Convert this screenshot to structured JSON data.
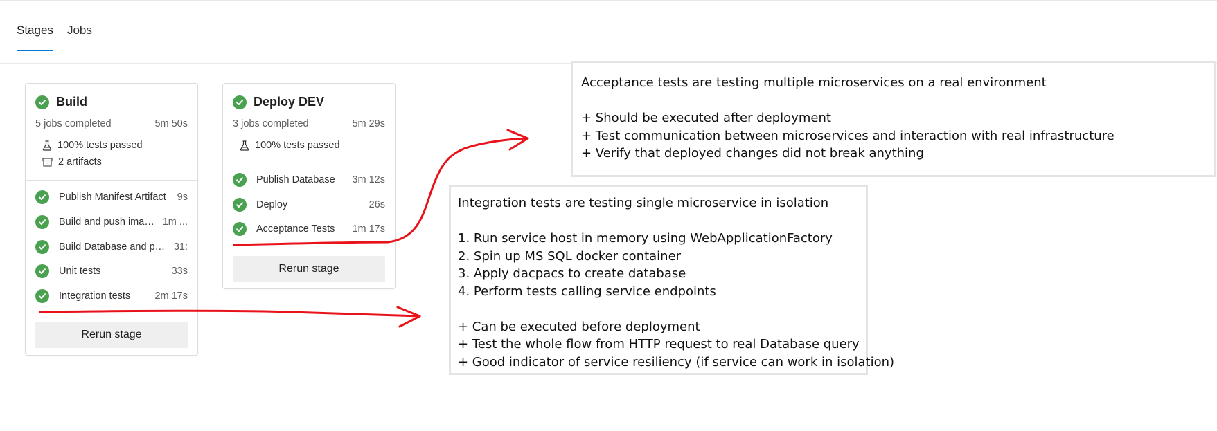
{
  "tabs": [
    {
      "label": "Stages",
      "active": true
    },
    {
      "label": "Jobs",
      "active": false
    }
  ],
  "stages": [
    {
      "title": "Build",
      "jobs_completed": "5 jobs completed",
      "duration": "5m 50s",
      "tests": "100% tests passed",
      "artifacts": "2 artifacts",
      "jobs": [
        {
          "name": "Publish Manifest Artifact",
          "time": "9s"
        },
        {
          "name": "Build and push image t...",
          "time": "1m ..."
        },
        {
          "name": "Build Database and publish...",
          "time": "31:"
        },
        {
          "name": "Unit tests",
          "time": "33s"
        },
        {
          "name": "Integration tests",
          "time": "2m 17s"
        }
      ],
      "rerun_label": "Rerun stage"
    },
    {
      "title": "Deploy DEV",
      "jobs_completed": "3 jobs completed",
      "duration": "5m 29s",
      "tests": "100% tests passed",
      "jobs": [
        {
          "name": "Publish Database",
          "time": "3m 12s"
        },
        {
          "name": "Deploy",
          "time": "26s"
        },
        {
          "name": "Acceptance Tests",
          "time": "1m 17s"
        }
      ],
      "rerun_label": "Rerun stage"
    }
  ],
  "notes": {
    "acceptance": [
      "Acceptance tests are testing multiple microservices on a real environment",
      "",
      "+ Should be executed after deployment",
      "+ Test communication between microservices and interaction with real infrastructure",
      "+ Verify that deployed changes did not break anything"
    ],
    "integration": [
      "Integration tests are testing single microservice in isolation",
      "",
      "1. Run service host in memory using WebApplicationFactory",
      "2. Spin up MS SQL docker container",
      "3. Apply dacpacs to create database",
      "4. Perform tests calling service endpoints",
      "",
      "+ Can be executed before deployment",
      "+ Test the whole flow from HTTP request to real Database query",
      "+ Good indicator of service resiliency (if service can work in isolation)"
    ]
  },
  "colors": {
    "success": "#4aa150",
    "accent": "#0078d4",
    "annotation": "#e8121a"
  },
  "icons": {
    "status": "check-circle-icon",
    "tests": "flask-icon",
    "artifacts": "artifact-box-icon"
  }
}
